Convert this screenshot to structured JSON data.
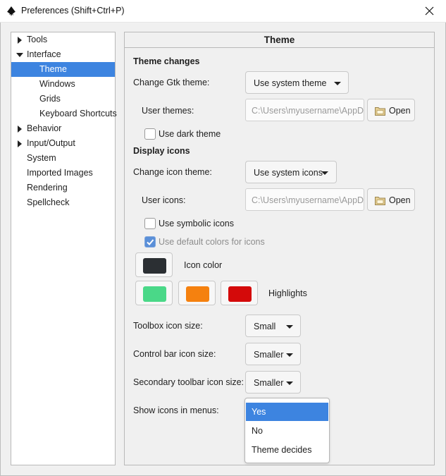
{
  "window": {
    "title": "Preferences (Shift+Ctrl+P)",
    "app_icon": "inkscape-logo-icon",
    "close_icon": "close-icon"
  },
  "sidebar": {
    "items": [
      {
        "label": "Tools",
        "expander": "collapsed"
      },
      {
        "label": "Interface",
        "expander": "expanded"
      },
      {
        "label": "Theme",
        "selected": true
      },
      {
        "label": "Windows"
      },
      {
        "label": "Grids"
      },
      {
        "label": "Keyboard Shortcuts"
      },
      {
        "label": "Behavior",
        "expander": "collapsed"
      },
      {
        "label": "Input/Output",
        "expander": "collapsed"
      },
      {
        "label": "System"
      },
      {
        "label": "Imported Images"
      },
      {
        "label": "Rendering"
      },
      {
        "label": "Spellcheck"
      }
    ]
  },
  "panel": {
    "header": "Theme",
    "theme_changes": {
      "heading": "Theme changes",
      "gtk_theme_label": "Change Gtk theme:",
      "gtk_theme_value": "Use system theme",
      "user_themes_label": "User themes:",
      "user_themes_path": "C:\\Users\\myusername\\AppData\\Roaming\\inkscape\\themes",
      "open_label": "Open",
      "dark_theme_label": "Use dark theme",
      "dark_theme_checked": false
    },
    "display_icons": {
      "heading": "Display icons",
      "icon_theme_label": "Change icon theme:",
      "icon_theme_value": "Use system icons",
      "user_icons_label": "User icons:",
      "user_icons_path": "C:\\Users\\myusername\\AppData\\Roaming\\inkscape\\icons",
      "open_label": "Open",
      "symbolic_label": "Use symbolic icons",
      "symbolic_checked": false,
      "default_colors_label": "Use default colors for icons",
      "default_colors_checked": true,
      "icon_color_label": "Icon color",
      "icon_color": "#2b2f33",
      "highlights_label": "Highlights",
      "highlight_colors": [
        "#4ad888",
        "#f5810f",
        "#d40a0a"
      ]
    },
    "sizes": {
      "toolbox_label": "Toolbox icon size:",
      "toolbox_value": "Small",
      "control_bar_label": "Control bar icon size:",
      "control_bar_value": "Smaller",
      "secondary_label": "Secondary toolbar icon size:",
      "secondary_value": "Smaller",
      "menus_label": "Show icons in menus:"
    },
    "menus_popup": {
      "options": [
        "Yes",
        "No",
        "Theme decides"
      ],
      "selected": "Yes"
    }
  },
  "colors": {
    "selection": "#3d84e0"
  }
}
